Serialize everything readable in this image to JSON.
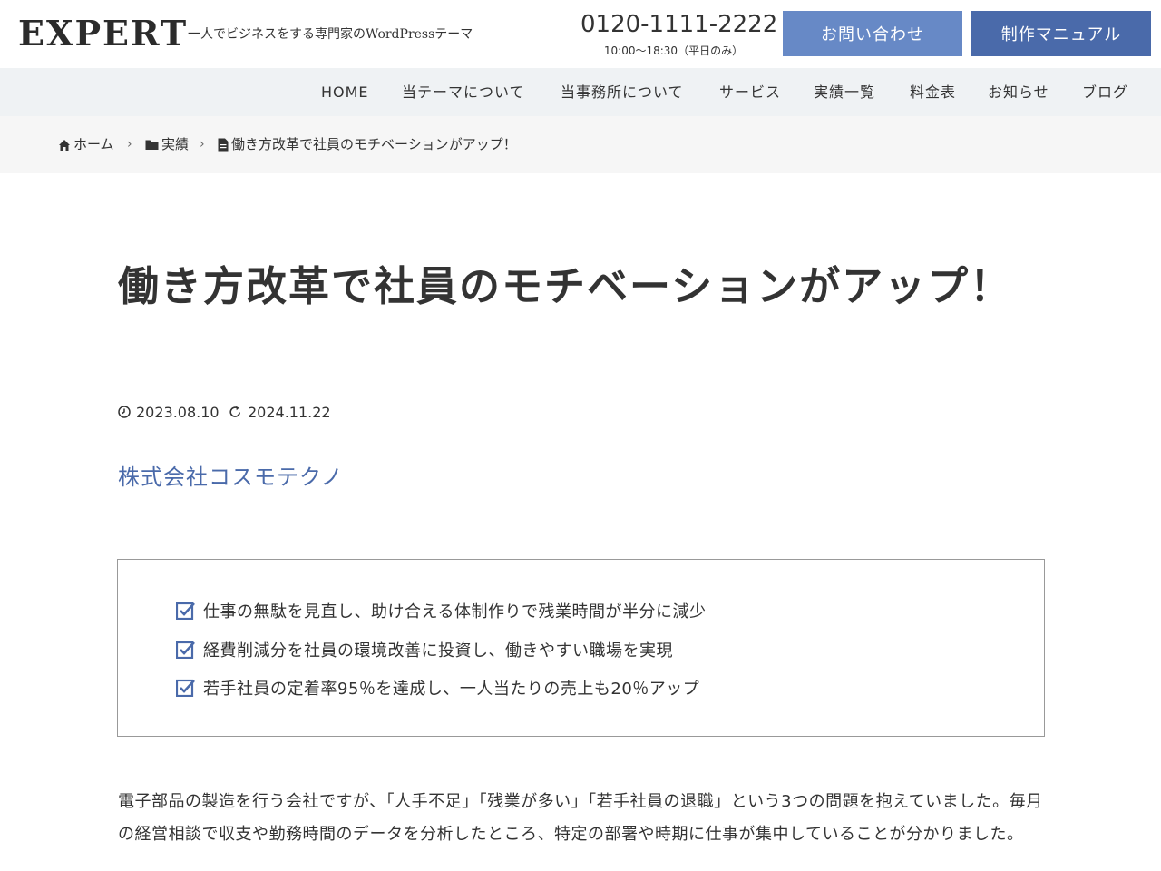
{
  "header": {
    "logo": "EXPERT",
    "tagline": "一人でビジネスをする専門家のWordPressテーマ",
    "phone": "0120-1111-2222",
    "hours": "10:00〜18:30（平日のみ）",
    "contact_button": "お問い合わせ",
    "manual_button": "制作マニュアル"
  },
  "nav": {
    "items": [
      "HOME",
      "当テーマについて",
      "当事務所について",
      "サービス",
      "実績一覧",
      "料金表",
      "お知らせ",
      "ブログ"
    ]
  },
  "breadcrumb": {
    "home": "ホーム",
    "category": "実績",
    "current": "働き方改革で社員のモチベーションがアップ！"
  },
  "article": {
    "title": "働き方改革で社員のモチベーションがアップ！",
    "published": "2023.08.10",
    "updated": "2024.11.22",
    "company": "株式会社コスモテクノ",
    "highlights": [
      "仕事の無駄を見直し、助け合える体制作りで残業時間が半分に減少",
      "経費削減分を社員の環境改善に投資し、働きやすい職場を実現",
      "若手社員の定着率95％を達成し、一人当たりの売上も20％アップ"
    ],
    "body": "電子部品の製造を行う会社ですが、「人手不足」「残業が多い」「若手社員の退職」という3つの問題を抱えていました。毎月の経営相談で収支や勤務時間のデータを分析したところ、特定の部署や時期に仕事が集中していることが分かりました。"
  },
  "colors": {
    "accent": "#4a6aaa",
    "button_light": "#6789c6",
    "nav_bg": "#eff2f4",
    "breadcrumb_bg": "#f6f6f6"
  }
}
